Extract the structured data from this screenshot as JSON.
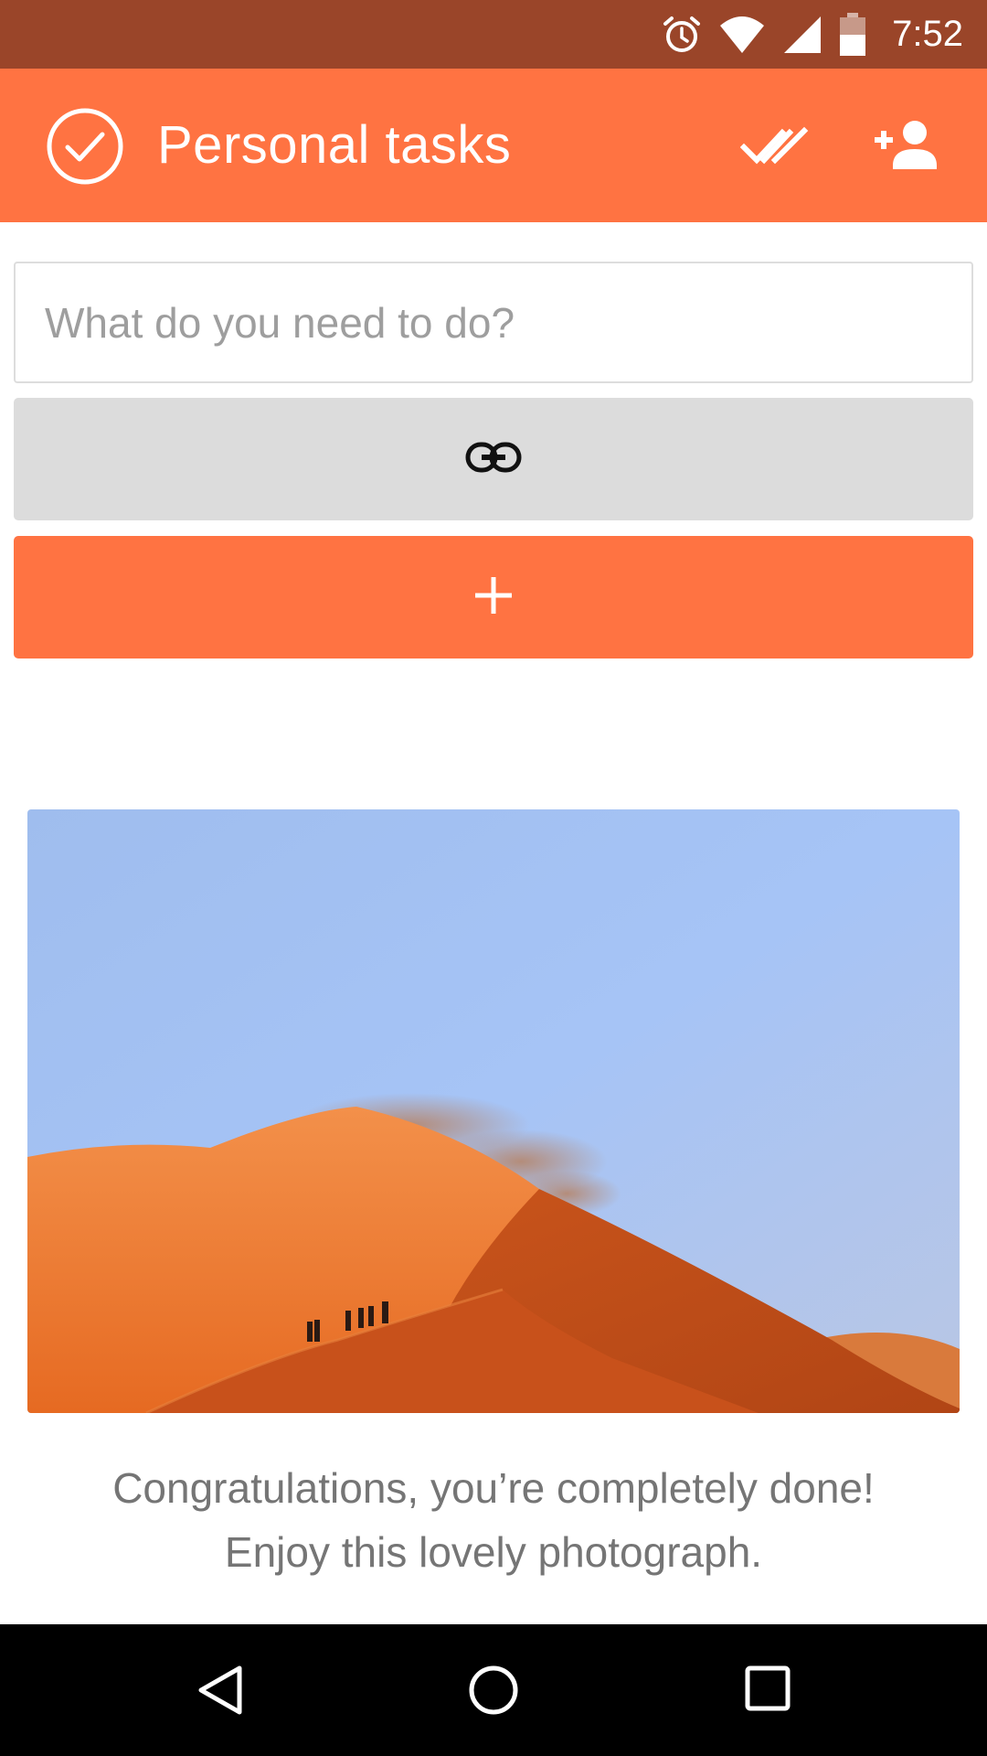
{
  "status_bar": {
    "time": "7:52",
    "icons": [
      "alarm-icon",
      "wifi-icon",
      "signal-icon",
      "battery-icon"
    ]
  },
  "app_bar": {
    "title": "Personal tasks",
    "logo_icon": "check-circle-icon",
    "actions": [
      "mark-all-done-icon",
      "add-person-icon"
    ],
    "color": "#ff7342"
  },
  "task_input": {
    "placeholder": "What do you need to do?",
    "value": ""
  },
  "link_button": {
    "icon": "link-icon",
    "color": "#dcdcdc"
  },
  "add_button": {
    "icon": "plus-icon",
    "color": "#ff7342"
  },
  "photo": {
    "subject": "desert-dunes-with-hikers"
  },
  "message": {
    "line1": "Congratulations, you’re completely done!",
    "line2": "Enjoy this lovely photograph."
  },
  "nav_bar": {
    "buttons": [
      "back-icon",
      "home-icon",
      "recents-icon"
    ]
  }
}
